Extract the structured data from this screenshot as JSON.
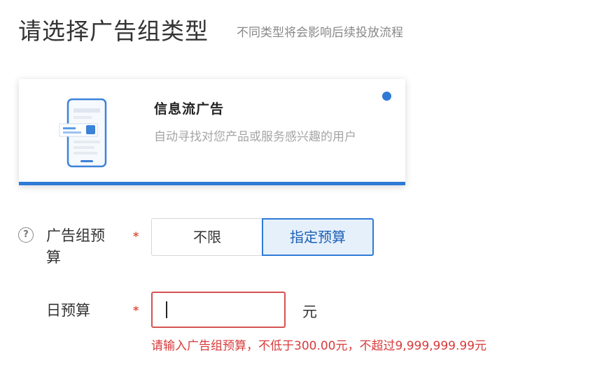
{
  "header": {
    "title": "请选择广告组类型",
    "subtitle": "不同类型将会影响后续投放流程"
  },
  "ad_type_card": {
    "title": "信息流广告",
    "description": "自动寻找对您产品或服务感兴趣的用户",
    "selected": true,
    "accent_color": "#2e7ad6"
  },
  "budget": {
    "label": "广告组预算",
    "required_mark": "*",
    "options": [
      {
        "label": "不限",
        "selected": false
      },
      {
        "label": "指定预算",
        "selected": true
      }
    ]
  },
  "daily_budget": {
    "label": "日预算",
    "required_mark": "*",
    "value": "",
    "unit": "元",
    "error": "请输入广告组预算，不低于300.00元，不超过9,999,999.99元"
  },
  "colors": {
    "primary": "#2e7ad6",
    "error": "#d83a3a"
  }
}
